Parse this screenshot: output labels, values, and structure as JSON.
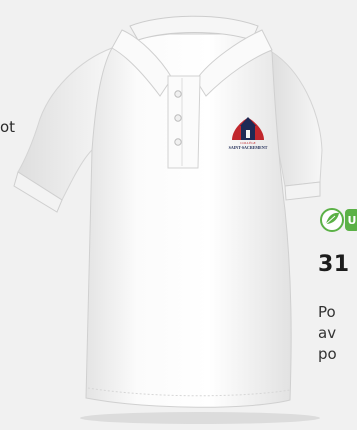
{
  "left_fragment": "ot",
  "logo": {
    "line1": "COLLÈGE",
    "line2": "SAINT-SACREMENT"
  },
  "badge": {
    "icon": "leaf-icon",
    "color": "#5bb146",
    "letter": "U"
  },
  "price": "31",
  "description_lines": [
    "Po",
    "av",
    "po"
  ]
}
